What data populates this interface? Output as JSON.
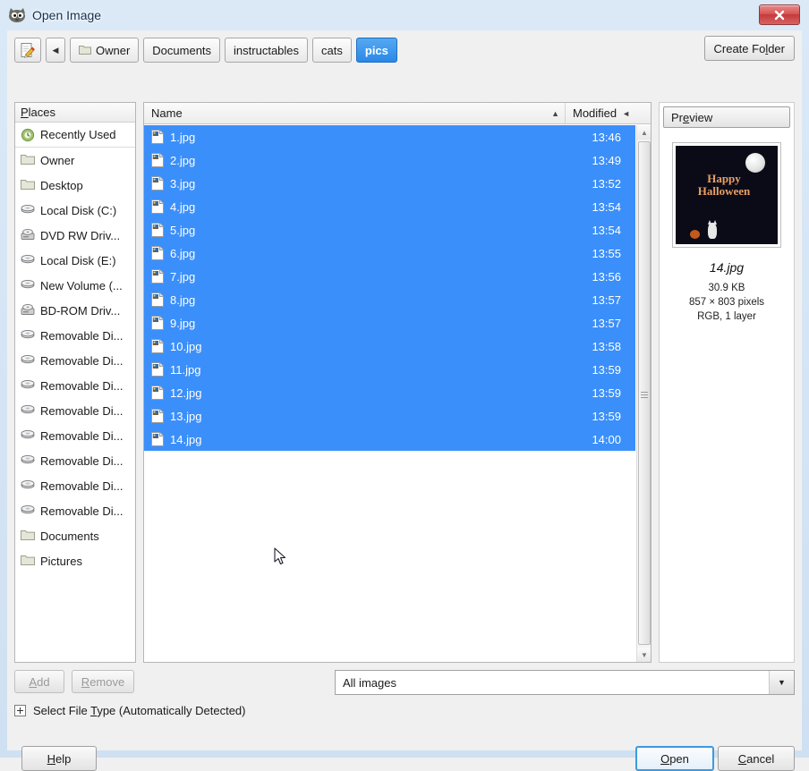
{
  "window": {
    "title": "Open Image",
    "app_icon": "gimp-wilber-icon",
    "close_label": "×"
  },
  "pathbar": {
    "location_toggle_icon": "type-filename-pencil-icon",
    "back_icon": "chevron-left-icon",
    "crumbs": [
      {
        "label": "Owner",
        "icon": "folder-icon",
        "active": false
      },
      {
        "label": "Documents",
        "icon": "",
        "active": false
      },
      {
        "label": "instructables",
        "icon": "",
        "active": false
      },
      {
        "label": "cats",
        "icon": "",
        "active": false
      },
      {
        "label": "pics",
        "icon": "",
        "active": true
      }
    ],
    "create_folder": "Create Folder"
  },
  "places": {
    "header": "Places",
    "items": [
      {
        "label": "Recently Used",
        "icon": "recent-clock-icon"
      },
      {
        "label": "Owner",
        "icon": "folder-icon"
      },
      {
        "label": "Desktop",
        "icon": "folder-icon"
      },
      {
        "label": "Local Disk (C:)",
        "icon": "harddisk-icon"
      },
      {
        "label": "DVD RW Driv...",
        "icon": "optical-drive-icon"
      },
      {
        "label": "Local Disk (E:)",
        "icon": "harddisk-icon"
      },
      {
        "label": "New Volume (...",
        "icon": "harddisk-icon"
      },
      {
        "label": "BD-ROM Driv...",
        "icon": "optical-drive-icon"
      },
      {
        "label": "Removable Di...",
        "icon": "harddisk-icon"
      },
      {
        "label": "Removable Di...",
        "icon": "harddisk-icon"
      },
      {
        "label": "Removable Di...",
        "icon": "harddisk-icon"
      },
      {
        "label": "Removable Di...",
        "icon": "harddisk-icon"
      },
      {
        "label": "Removable Di...",
        "icon": "harddisk-icon"
      },
      {
        "label": "Removable Di...",
        "icon": "harddisk-icon"
      },
      {
        "label": "Removable Di...",
        "icon": "harddisk-icon"
      },
      {
        "label": "Removable Di...",
        "icon": "harddisk-icon"
      },
      {
        "label": "Documents",
        "icon": "folder-icon"
      },
      {
        "label": "Pictures",
        "icon": "folder-icon"
      }
    ]
  },
  "filelist": {
    "columns": {
      "name": "Name",
      "modified": "Modified"
    },
    "sort_indicator": "▲",
    "modified_indicator": "◄",
    "selection_color": "#3b8ffa",
    "rows": [
      {
        "name": "1.jpg",
        "modified": "13:46",
        "selected": true
      },
      {
        "name": "2.jpg",
        "modified": "13:49",
        "selected": true
      },
      {
        "name": "3.jpg",
        "modified": "13:52",
        "selected": true
      },
      {
        "name": "4.jpg",
        "modified": "13:54",
        "selected": true
      },
      {
        "name": "5.jpg",
        "modified": "13:54",
        "selected": true
      },
      {
        "name": "6.jpg",
        "modified": "13:55",
        "selected": true
      },
      {
        "name": "7.jpg",
        "modified": "13:56",
        "selected": true
      },
      {
        "name": "8.jpg",
        "modified": "13:57",
        "selected": true
      },
      {
        "name": "9.jpg",
        "modified": "13:57",
        "selected": true
      },
      {
        "name": "10.jpg",
        "modified": "13:58",
        "selected": true
      },
      {
        "name": "11.jpg",
        "modified": "13:59",
        "selected": true
      },
      {
        "name": "12.jpg",
        "modified": "13:59",
        "selected": true
      },
      {
        "name": "13.jpg",
        "modified": "13:59",
        "selected": true
      },
      {
        "name": "14.jpg",
        "modified": "14:00",
        "selected": true
      }
    ]
  },
  "preview": {
    "header": "Preview",
    "image_text_line1": "Happy",
    "image_text_line2": "Halloween",
    "filename": "14.jpg",
    "filesize": "30.9 KB",
    "dimensions": "857 × 803 pixels",
    "colormode": "RGB, 1 layer"
  },
  "footer": {
    "add": "Add",
    "remove": "Remove",
    "filter_value": "All images",
    "filetype_label": "Select File Type (Automatically Detected)",
    "help": "Help",
    "open": "Open",
    "cancel": "Cancel"
  }
}
